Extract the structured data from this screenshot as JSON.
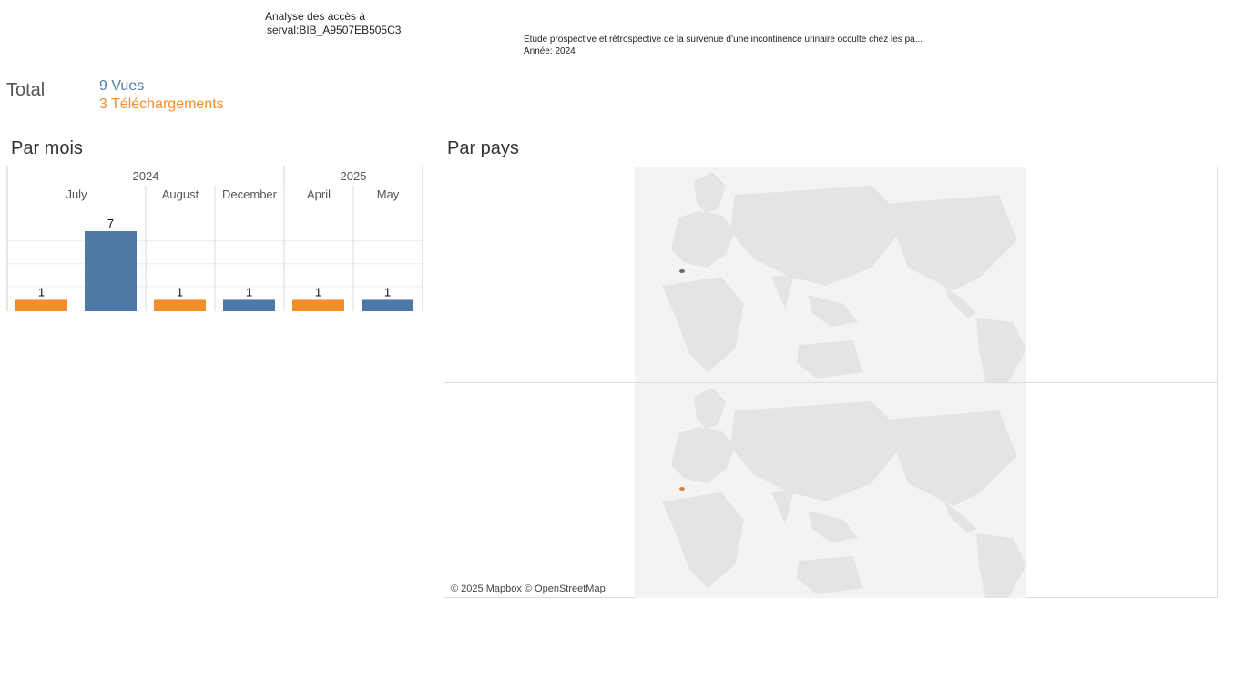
{
  "header": {
    "title_line1": "Analyse des accès à",
    "title_line2": "serval:BIB_A9507EB505C3",
    "doc_title": "Etude prospective et rétrospective de la survenue d’une incontinence urinaire occulte chez les pa...",
    "doc_year": "Année: 2024"
  },
  "totals": {
    "label": "Total",
    "views": "9 Vues",
    "downloads": "3 Téléchargements"
  },
  "sections": {
    "by_month": "Par mois",
    "by_country": "Par pays"
  },
  "colors": {
    "views": "#4e79a7",
    "downloads": "#f28e2b"
  },
  "chart_data": {
    "type": "bar",
    "title": "Par mois",
    "years": [
      {
        "label": "2024",
        "months": [
          "July",
          "August",
          "December"
        ]
      },
      {
        "label": "2025",
        "months": [
          "April",
          "May"
        ]
      }
    ],
    "bars": [
      {
        "month": "July",
        "year": "2024",
        "kind": "downloads",
        "value": 1
      },
      {
        "month": "July",
        "year": "2024",
        "kind": "views",
        "value": 7
      },
      {
        "month": "August",
        "year": "2024",
        "kind": "downloads",
        "value": 1
      },
      {
        "month": "December",
        "year": "2024",
        "kind": "views",
        "value": 1
      },
      {
        "month": "April",
        "year": "2025",
        "kind": "downloads",
        "value": 1
      },
      {
        "month": "May",
        "year": "2025",
        "kind": "views",
        "value": 1
      }
    ],
    "ylim": [
      0,
      7
    ],
    "grid": true
  },
  "map": {
    "credit": "© 2025 Mapbox © OpenStreetMap",
    "panels": [
      {
        "kind": "views",
        "highlight": "Switzerland"
      },
      {
        "kind": "downloads",
        "highlight": "Switzerland"
      }
    ]
  }
}
